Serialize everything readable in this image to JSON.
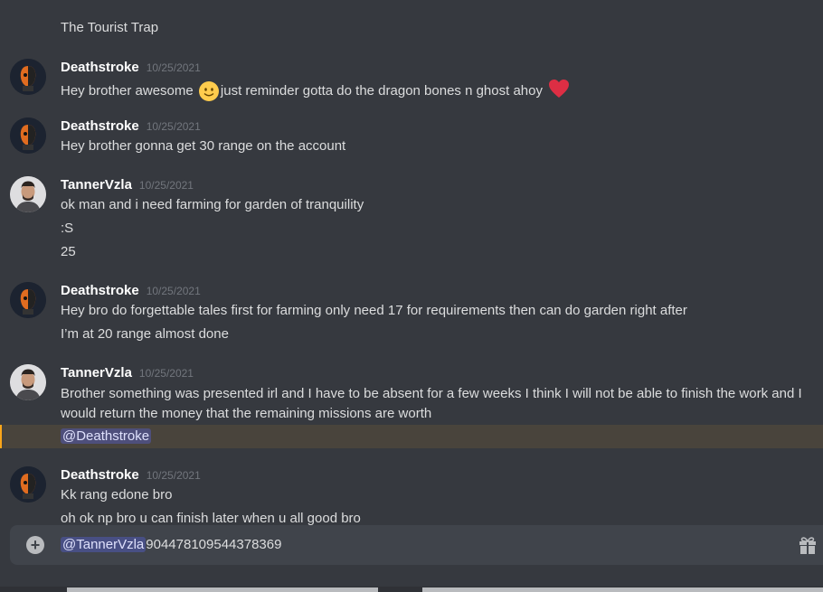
{
  "channel_header": {
    "title": "The Tourist Trap"
  },
  "messages": [
    {
      "author": "Deathstroke",
      "time": "10/25/2021",
      "lines": [
        "Hey brother awesome",
        "just reminder gotta do the dragon bones n ghost ahoy"
      ],
      "emojis": [
        "slightly-smiling-face",
        "red-heart"
      ]
    },
    {
      "author": "Deathstroke",
      "time": "10/25/2021",
      "lines": [
        "Hey brother gonna get 30 range on the account"
      ]
    },
    {
      "author": "TannerVzla",
      "time": "10/25/2021",
      "lines": [
        "ok man and i need farming for garden of tranquility",
        ":S",
        "25"
      ]
    },
    {
      "author": "Deathstroke",
      "time": "10/25/2021",
      "lines": [
        "Hey bro do forgettable tales first for farming only need 17 for requirements then can do garden right after",
        "I’m at 20 range almost done"
      ]
    },
    {
      "author": "TannerVzla",
      "time": "10/25/2021",
      "lines": [
        "Brother something was presented irl and I have to be absent for a few weeks I think I will not be able to finish the work and I would return the money that the remaining missions are worth"
      ],
      "mention": "@Deathstroke"
    },
    {
      "author": "Deathstroke",
      "time": "10/25/2021",
      "lines": [
        "Kk rang edone bro",
        "oh ok np bro u can finish later when u all good bro"
      ]
    }
  ],
  "composer": {
    "mention": "@TannerVzla",
    "text": "904478109544378369"
  },
  "colors": {
    "background": "#36393f",
    "input": "#40444b",
    "mention_bg": "#5865f2",
    "highlight": "#49443c"
  }
}
